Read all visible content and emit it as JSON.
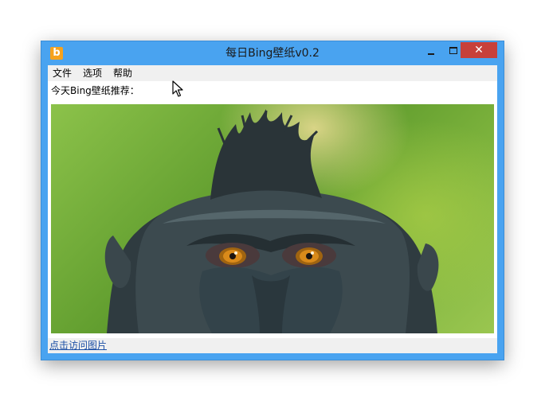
{
  "window": {
    "title": "每日Bing壁纸v0.2",
    "icon_letter": "b",
    "controls": {
      "minimize": "minimize-icon",
      "maximize": "maximize-icon",
      "close": "✕"
    }
  },
  "menu": [
    "文件",
    "选项",
    "帮助"
  ],
  "main": {
    "intro_label": "今天Bing壁纸推荐：",
    "image_subject": "monkey-wallpaper-image"
  },
  "footer": {
    "link_text": "点击访问图片"
  },
  "colors": {
    "frame": "#49a3f0",
    "close": "#c7403a",
    "menu_bg": "#f0f0f0",
    "link": "#1c4fa5",
    "icon": "#f6a21d"
  }
}
